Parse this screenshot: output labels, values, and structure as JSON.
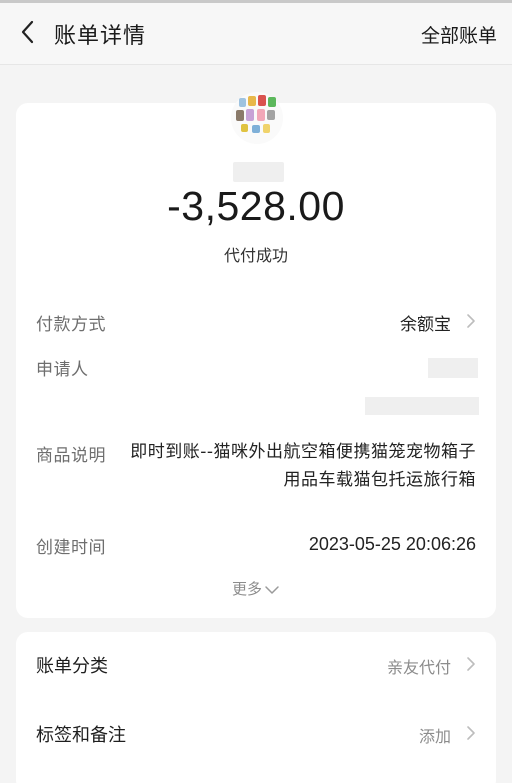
{
  "nav": {
    "title": "账单详情",
    "right_link": "全部账单"
  },
  "summary": {
    "amount": "-3,528.00",
    "status": "代付成功"
  },
  "details": {
    "payment_method_label": "付款方式",
    "payment_method_value": "余额宝",
    "applicant_label": "申请人",
    "product_desc_label": "商品说明",
    "product_desc_value": "即时到账--猫咪外出航空箱便携猫笼宠物箱子用品车载猫包托运旅行箱",
    "created_time_label": "创建时间",
    "created_time_value": "2023-05-25 20:06:26",
    "more_label": "更多"
  },
  "extra": {
    "category_label": "账单分类",
    "category_value": "亲友代付",
    "tags_label": "标签和备注",
    "tags_value": "添加"
  },
  "colors": {
    "background": "#f4f4f4",
    "card": "#ffffff",
    "label_gray": "#6e6e6e",
    "muted_gray": "#8c8c8c"
  },
  "icons": {
    "back": "chevron-left-icon",
    "row_arrow": "chevron-right-icon",
    "more": "chevron-down-icon"
  }
}
